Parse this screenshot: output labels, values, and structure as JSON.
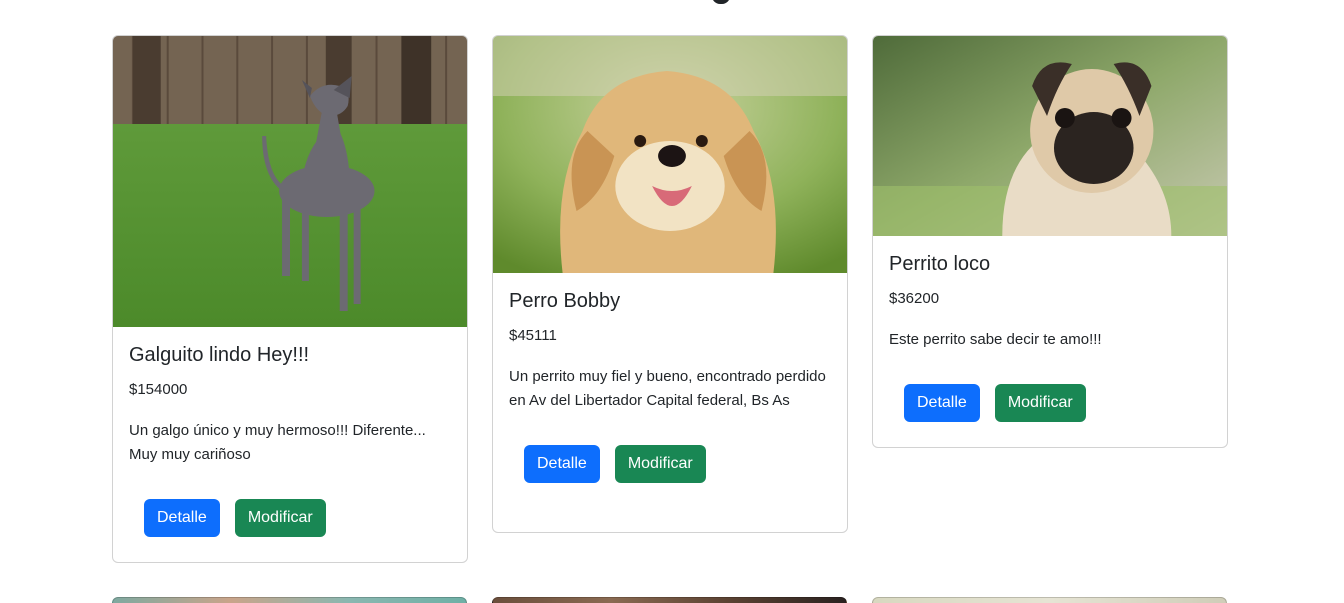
{
  "colors": {
    "primary": "#0d6efd",
    "success": "#198754"
  },
  "cards": [
    {
      "title": "Galguito lindo Hey!!!",
      "price": "$154000",
      "description": "Un galgo único y muy hermoso!!! Diferente... Muy muy cariñoso",
      "detail_label": "Detalle",
      "modify_label": "Modificar",
      "image": "greyhound-dog-photo"
    },
    {
      "title": "Perro Bobby",
      "price": "$45111",
      "description": "Un perrito muy fiel y bueno, encontrado perdido en Av del Libertador Capital federal, Bs As",
      "detail_label": "Detalle",
      "modify_label": "Modificar",
      "image": "golden-retriever-photo"
    },
    {
      "title": "Perrito loco",
      "price": "$36200",
      "description": "Este perrito sabe decir te amo!!!",
      "detail_label": "Detalle",
      "modify_label": "Modificar",
      "image": "pug-photo"
    }
  ]
}
